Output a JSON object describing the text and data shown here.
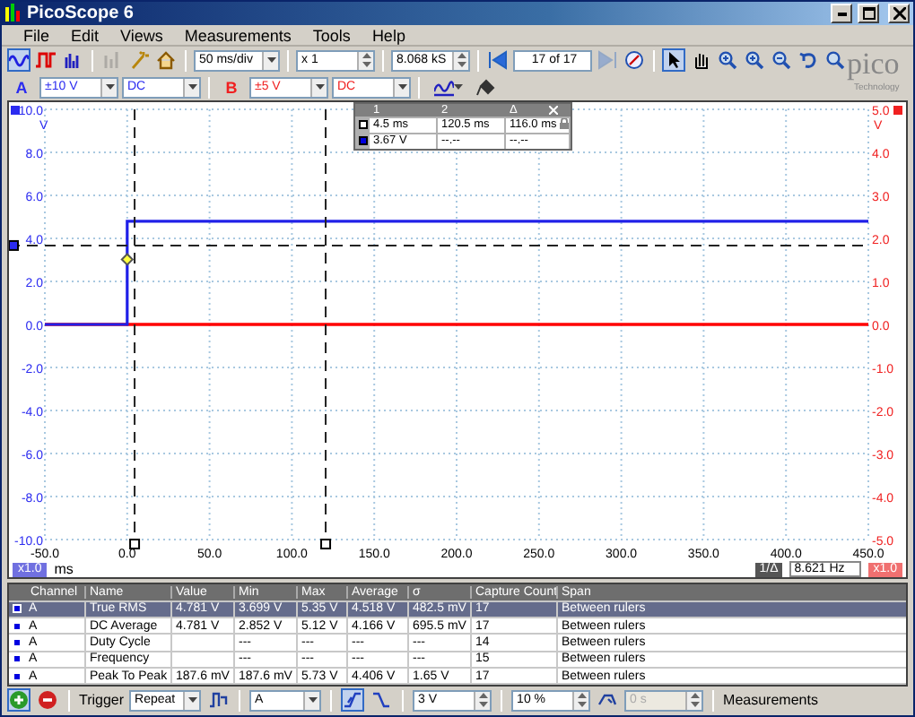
{
  "window": {
    "title": "PicoScope 6"
  },
  "menu": [
    {
      "label": "File"
    },
    {
      "label": "Edit"
    },
    {
      "label": "Views"
    },
    {
      "label": "Measurements"
    },
    {
      "label": "Tools"
    },
    {
      "label": "Help"
    }
  ],
  "toolbar": {
    "modes": [
      {
        "kind": "scope",
        "selected": true
      },
      {
        "kind": "persistence",
        "selected": false
      },
      {
        "kind": "spectrum",
        "selected": false
      }
    ],
    "extras": [
      {
        "kind": "measure",
        "disabled": true
      },
      {
        "kind": "wand",
        "disabled": false
      },
      {
        "kind": "home",
        "disabled": false
      }
    ],
    "timebase": "50 ms/div",
    "zoom": "x 1",
    "samples": "8.068 kS",
    "navigation": [
      {
        "kind": "back",
        "disabled": false
      },
      {
        "kind": "field"
      },
      {
        "kind": "forward",
        "disabled": true
      },
      {
        "kind": "compass",
        "disabled": false
      }
    ],
    "buffer": "17 of 17",
    "tools": [
      {
        "kind": "pointer",
        "selected": true
      },
      {
        "kind": "hand",
        "selected": false
      },
      {
        "kind": "zoom-in",
        "selected": false
      },
      {
        "kind": "zoom-in",
        "selected": false
      },
      {
        "kind": "zoom-out",
        "selected": false
      },
      {
        "kind": "undo",
        "selected": false
      },
      {
        "kind": "zoom",
        "selected": false
      }
    ]
  },
  "logo": {
    "name": "pico",
    "tagline": "Technology"
  },
  "channels": [
    {
      "label": "A",
      "range": "±10 V",
      "coupling": "DC",
      "color": "#2b2bf0"
    },
    {
      "label": "B",
      "range": "±5 V",
      "coupling": "DC",
      "color": "#f02020"
    }
  ],
  "scope": {
    "chart_data": {
      "type": "line",
      "x": [
        -50,
        0,
        0,
        450
      ],
      "series": [
        {
          "color": "#2020e8",
          "values": [
            0,
            0,
            4.8,
            4.8
          ]
        },
        {
          "color": "#ff0000",
          "values": [
            0,
            0,
            0,
            0
          ]
        }
      ],
      "grid": true,
      "xlim": [
        -50,
        450
      ],
      "ylim": [
        -10,
        10
      ],
      "xticks": [
        {
          "value": -50,
          "label": "-50.0"
        },
        {
          "value": 0,
          "label": "0.0"
        },
        {
          "value": 50,
          "label": "50.0"
        },
        {
          "value": 100,
          "label": "100.0"
        },
        {
          "value": 150,
          "label": "150.0"
        },
        {
          "value": 200,
          "label": "200.0"
        },
        {
          "value": 250,
          "label": "250.0"
        },
        {
          "value": 300,
          "label": "300.0"
        },
        {
          "value": 350,
          "label": "350.0"
        },
        {
          "value": 400,
          "label": "400.0"
        },
        {
          "value": 450,
          "label": "450.0"
        }
      ],
      "yticks": [
        {
          "value": 10,
          "label": "10.0"
        },
        {
          "value": 8,
          "label": "8.0"
        },
        {
          "value": 6,
          "label": "6.0"
        },
        {
          "value": 4,
          "label": "4.0"
        },
        {
          "value": 2,
          "label": "2.0"
        },
        {
          "value": 0,
          "label": "0.0"
        },
        {
          "value": -2,
          "label": "-2.0"
        },
        {
          "value": -4,
          "label": "-4.0"
        },
        {
          "value": -6,
          "label": "-6.0"
        },
        {
          "value": -8,
          "label": "-8.0"
        },
        {
          "value": -10,
          "label": "-10.0"
        }
      ],
      "ref_lines": [
        {
          "axis": "x",
          "value": 4.5
        },
        {
          "axis": "x",
          "value": 120.5
        },
        {
          "axis": "y",
          "value": 3.67
        }
      ]
    },
    "left_unit": "V",
    "right_unit": "V",
    "right_ticks": [
      "5.0",
      "4.0",
      "3.0",
      "2.0",
      "1.0",
      "0.0",
      "-1.0",
      "-2.0",
      "-3.0",
      "-4.0",
      "-5.0"
    ],
    "x_zoom": "x1.0",
    "x_unit": "ms",
    "right_zoom": "x1.0",
    "frequency_label": "1/Δ",
    "frequency": "8.621 Hz",
    "rulers": {
      "columns": [
        "1",
        "2",
        "Δ"
      ],
      "rows": [
        {
          "kind": "time",
          "cells": [
            "4.5 ms",
            "120.5 ms",
            "116.0 ms"
          ],
          "locked": true
        },
        {
          "kind": "channel",
          "color": "#0000e0",
          "cells": [
            "3.67 V",
            "--.--",
            "--.--"
          ],
          "locked": false
        }
      ]
    }
  },
  "measurements": {
    "columns": [
      "Channel",
      "Name",
      "Value",
      "Min",
      "Max",
      "Average",
      "σ",
      "Capture Count",
      "Span"
    ],
    "rows": [
      {
        "selected": true,
        "color": "#0000e0",
        "cells": [
          "A",
          "True RMS",
          "4.781 V",
          "3.699 V",
          "5.35 V",
          "4.518 V",
          "482.5 mV",
          "17",
          "Between rulers"
        ]
      },
      {
        "selected": false,
        "color": "#0000e0",
        "cells": [
          "A",
          "DC Average",
          "4.781 V",
          "2.852 V",
          "5.12 V",
          "4.166 V",
          "695.5 mV",
          "17",
          "Between rulers"
        ]
      },
      {
        "selected": false,
        "color": "#0000e0",
        "cells": [
          "A",
          "Duty Cycle",
          null,
          "---",
          "---",
          "---",
          "---",
          "14",
          "Between rulers"
        ]
      },
      {
        "selected": false,
        "color": "#0000e0",
        "cells": [
          "A",
          "Frequency",
          null,
          "---",
          "---",
          "---",
          "---",
          "15",
          "Between rulers"
        ]
      },
      {
        "selected": false,
        "color": "#0000e0",
        "cells": [
          "A",
          "Peak To Peak",
          "187.6 mV",
          "187.6 mV",
          "5.73 V",
          "4.406 V",
          "1.65 V",
          "17",
          "Between rulers"
        ]
      }
    ]
  },
  "trigger_bar": {
    "run_selected": true,
    "label": "Trigger",
    "mode": "Repeat",
    "source": "A",
    "edges": [
      {
        "kind": "rising",
        "selected": true
      },
      {
        "kind": "falling",
        "selected": false
      }
    ],
    "threshold": "3 V",
    "pre_trigger": "10 %",
    "delay": "0 s",
    "delay_disabled": true,
    "measurements_label": "Measurements"
  }
}
